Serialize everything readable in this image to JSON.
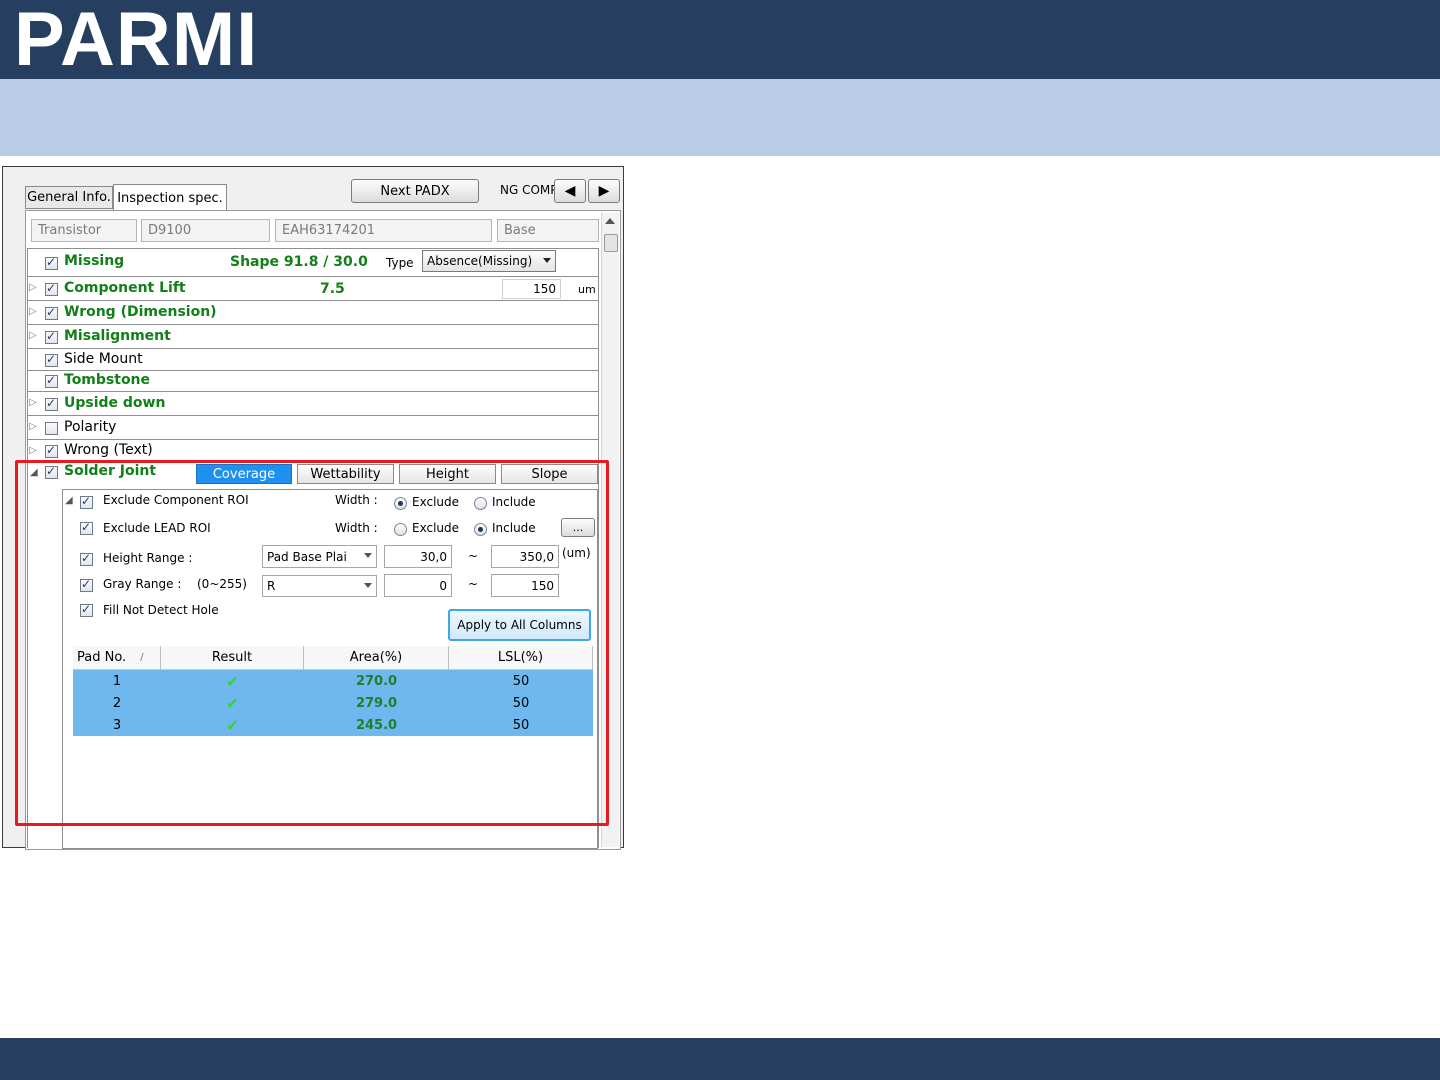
{
  "brand": {
    "logo_text": "PARMI"
  },
  "tabs": {
    "general": "General Info.",
    "inspection": "Inspection spec."
  },
  "toolbar": {
    "next_padx": "Next PADX",
    "ng_comp": "NG COMP"
  },
  "info_fields": [
    "Transistor",
    "D9100",
    "EAH63174201",
    "Base"
  ],
  "items": {
    "missing": {
      "label": "Missing",
      "shape": "Shape 91.8 / 30.0",
      "type_label": "Type",
      "type_value": "Absence(Missing)"
    },
    "component_lift": {
      "label": "Component  Lift",
      "value": "7.5",
      "limit": "150",
      "unit": "um"
    },
    "wrong_dimension": {
      "label": "Wrong (Dimension)"
    },
    "misalignment": {
      "label": "Misalignment"
    },
    "side_mount": {
      "label": "Side Mount"
    },
    "tombstone": {
      "label": "Tombstone"
    },
    "upside_down": {
      "label": "Upside down"
    },
    "polarity": {
      "label": "Polarity"
    },
    "wrong_text": {
      "label": "Wrong (Text)"
    },
    "solder_joint": {
      "label": "Solder Joint"
    }
  },
  "solder_tabs": [
    "Coverage",
    "Wettability",
    "Height",
    "Slope"
  ],
  "solder": {
    "exclude_component_roi": "Exclude Component ROI",
    "exclude_lead_roi": "Exclude LEAD ROI",
    "width_label": "Width :",
    "exclude": "Exclude",
    "include": "Include",
    "ellipsis": "...",
    "height_range": "Height Range :",
    "height_combo": "Pad Base Plai",
    "height_min": "30,0",
    "height_max": "350,0",
    "tilde": "~",
    "um_unit": "(um)",
    "gray_range": "Gray Range :",
    "gray_hint": "(0~255)",
    "gray_combo": "R",
    "gray_min": "0",
    "gray_max": "150",
    "fill_not_detect": "Fill Not Detect Hole",
    "apply_all": "Apply to All Columns"
  },
  "table": {
    "headers": [
      "Pad No.",
      "Result",
      "Area(%)",
      "LSL(%)"
    ],
    "sort_indicator": "/",
    "rows": [
      {
        "pad": "1",
        "area": "270.0",
        "lsl": "50"
      },
      {
        "pad": "2",
        "area": "279.0",
        "lsl": "50"
      },
      {
        "pad": "3",
        "area": "245.0",
        "lsl": "50"
      }
    ]
  },
  "colors": {
    "header_bar": "#263f60",
    "sub_bar": "#b8cde5",
    "highlight_box": "#e31b23",
    "selected_row": "#6eb7ef",
    "ok_label": "#118018"
  },
  "icons": {
    "result_ok": "check-icon",
    "prev": "arrow-left-icon",
    "next": "arrow-right-icon"
  }
}
